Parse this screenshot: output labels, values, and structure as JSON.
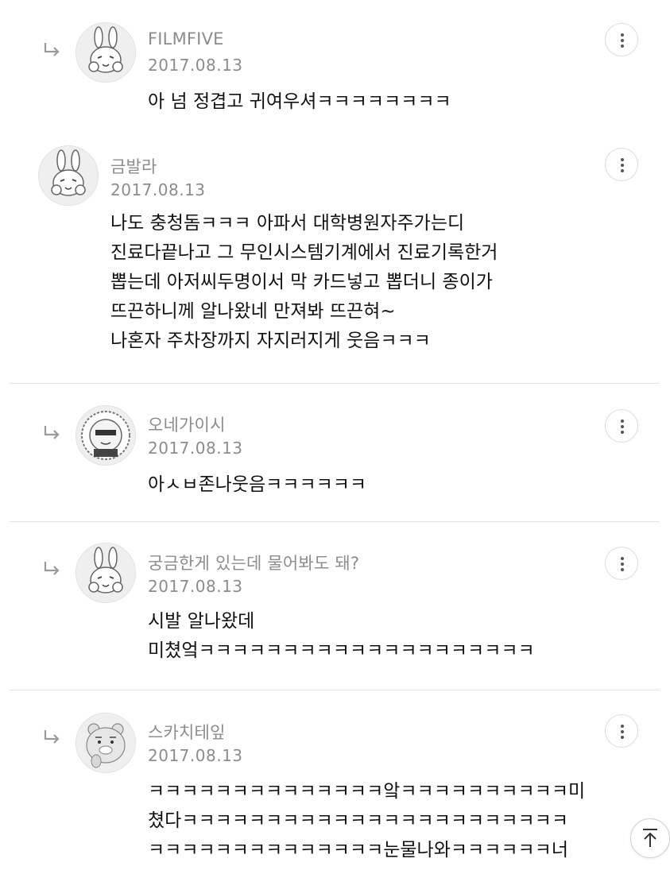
{
  "comments": [
    {
      "author": "FILMFIVE",
      "date": "2017.08.13",
      "lines": [
        "아 넘 정겹고 귀여우셔ㅋㅋㅋㅋㅋㅋㅋㅋ"
      ],
      "is_reply": true,
      "avatar": "rabbit-icon"
    },
    {
      "author": "금발라",
      "date": "2017.08.13",
      "lines": [
        "나도 충청돔ㅋㅋㅋ 아파서 대학병원자주가는디",
        "진료다끝나고 그 무인시스템기계에서 진료기록한거",
        "뽑는데 아저씨두명이서 막 카드넣고 뽑더니 종이가",
        "뜨끈하니께 알나왔네 만져봐 뜨끈혀~",
        "나혼자 주차장까지 자지러지게 웃음ㅋㅋㅋ"
      ],
      "is_reply": false,
      "avatar": "rabbit-icon"
    },
    {
      "author": "오네가이시",
      "date": "2017.08.13",
      "lines": [
        "아ㅅㅂ존나웃음ㅋㅋㅋㅋㅋㅋ"
      ],
      "is_reply": true,
      "avatar": "character-icon"
    },
    {
      "author": "궁금한게 있는데 물어봐도 돼?",
      "date": "2017.08.13",
      "lines": [
        "시발 알나왔데",
        "미쳤엌ㅋㅋㅋㅋㅋㅋㅋㅋㅋㅋㅋㅋㅋㅋㅋㅋㅋㅋㅋㅋ"
      ],
      "is_reply": true,
      "avatar": "rabbit-icon"
    },
    {
      "author": "스카치테잎",
      "date": "2017.08.13",
      "lines": [
        "ㅋㅋㅋㅋㅋㅋㅋㅋㅋㅋㅋㅋㅋㅋ앜ㅋㅋㅋㅋㅋㅋㅋㅋㅋㅋ미",
        "쳤다ㅋㅋㅋㅋㅋㅋㅋㅋㅋㅋㅋㅋㅋㅋㅋㅋㅋㅋㅋㅋㅋㅋㅋ",
        "ㅋㅋㅋㅋㅋㅋㅋㅋㅋㅋㅋㅋㅋㅋ눈물나와ㅋㅋㅋㅋㅋㅋ너"
      ],
      "is_reply": true,
      "avatar": "lion-icon"
    }
  ],
  "icons": {
    "reply": "reply-arrow-icon",
    "more": "more-vertical-icon",
    "scroll_top": "arrow-up-to-top-icon"
  },
  "colors": {
    "meta_text": "#8c8c8c",
    "body_text": "#111111",
    "divider": "#e4e4e4"
  }
}
